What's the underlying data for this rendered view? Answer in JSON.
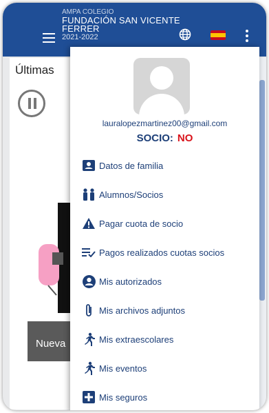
{
  "appbar": {
    "line1": "AMPA COLEGIO",
    "line2": "FUNDACIÓN SAN VICENTE",
    "line3": "FERRER",
    "line4": "2021-2022",
    "icons": [
      "menu-icon",
      "globe-icon",
      "spain-flag-icon",
      "more-vert-icon"
    ],
    "color": "#1f4e96"
  },
  "background": {
    "title": "Últimas",
    "button_label": "Nueva"
  },
  "drawer": {
    "email": "lauralopezmartinez00@gmail.com",
    "socio_label": "SOCIO:",
    "socio_value": "NO",
    "socio_value_color": "#d9121a",
    "items": [
      {
        "label": "Datos de familia",
        "icon": "contact-card-icon"
      },
      {
        "label": "Alumnos/Socios",
        "icon": "students-icon"
      },
      {
        "label": "Pagar cuota de socio",
        "icon": "warning-icon"
      },
      {
        "label": "Pagos realizados cuotas socios",
        "icon": "list-check-icon"
      },
      {
        "label": "Mis autorizados",
        "icon": "account-circle-icon"
      },
      {
        "label": "Mis archivos adjuntos",
        "icon": "attachment-icon"
      },
      {
        "label": "Mis extraescolares",
        "icon": "running-icon"
      },
      {
        "label": "Mis eventos",
        "icon": "running-icon"
      },
      {
        "label": "Mis seguros",
        "icon": "medical-plus-icon"
      }
    ]
  }
}
